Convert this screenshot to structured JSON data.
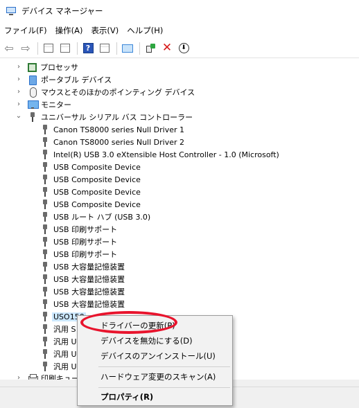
{
  "window": {
    "title": "デバイス マネージャー"
  },
  "menu": [
    "ファイル(F)",
    "操作(A)",
    "表示(V)",
    "ヘルプ(H)"
  ],
  "toolbar_icons": [
    "back-arrow-icon",
    "forward-arrow-icon",
    "properties-icon",
    "show-hidden-icon",
    "help-icon",
    "view-icon",
    "scan-hardware-icon",
    "add-driver-icon",
    "uninstall-icon",
    "update-driver-icon"
  ],
  "tree": {
    "categories_top": [
      {
        "label": "プロセッサ",
        "icon": "processor-icon"
      },
      {
        "label": "ポータブル デバイス",
        "icon": "portable-device-icon"
      },
      {
        "label": "マウスとそのほかのポインティング デバイス",
        "icon": "mouse-icon"
      },
      {
        "label": "モニター",
        "icon": "monitor-icon"
      }
    ],
    "usb_category": {
      "label": "ユニバーサル シリアル バス コントローラー",
      "icon": "usb-icon"
    },
    "usb_children": [
      "Canon TS8000 series Null Driver 1",
      "Canon TS8000 series Null Driver 2",
      "Intel(R) USB 3.0 eXtensible Host Controller - 1.0 (Microsoft)",
      "USB Composite Device",
      "USB Composite Device",
      "USB Composite Device",
      "USB Composite Device",
      "USB ルート ハブ (USB 3.0)",
      "USB 印刷サポート",
      "USB 印刷サポート",
      "USB 印刷サポート",
      "USB 大容量記憶装置",
      "USB 大容量記憶装置",
      "USB 大容量記憶装置",
      "USB 大容量記憶装置",
      "USO150",
      "汎用 S",
      "汎用 U",
      "汎用 U",
      "汎用 U"
    ],
    "bottom_category": {
      "label": "印刷キュー",
      "icon": "print-queue-icon"
    }
  },
  "context_menu": {
    "items": [
      {
        "label": "ドライバーの更新(P)",
        "bold": false
      },
      {
        "label": "デバイスを無効にする(D)",
        "bold": false
      },
      {
        "label": "デバイスのアンインストール(U)",
        "bold": false
      },
      {
        "label": "ハードウェア変更のスキャン(A)",
        "bold": false
      },
      {
        "label": "プロパティ(R)",
        "bold": true
      }
    ]
  },
  "colors": {
    "highlight_oval": "#e8142d",
    "selection": "#cce8ff"
  }
}
